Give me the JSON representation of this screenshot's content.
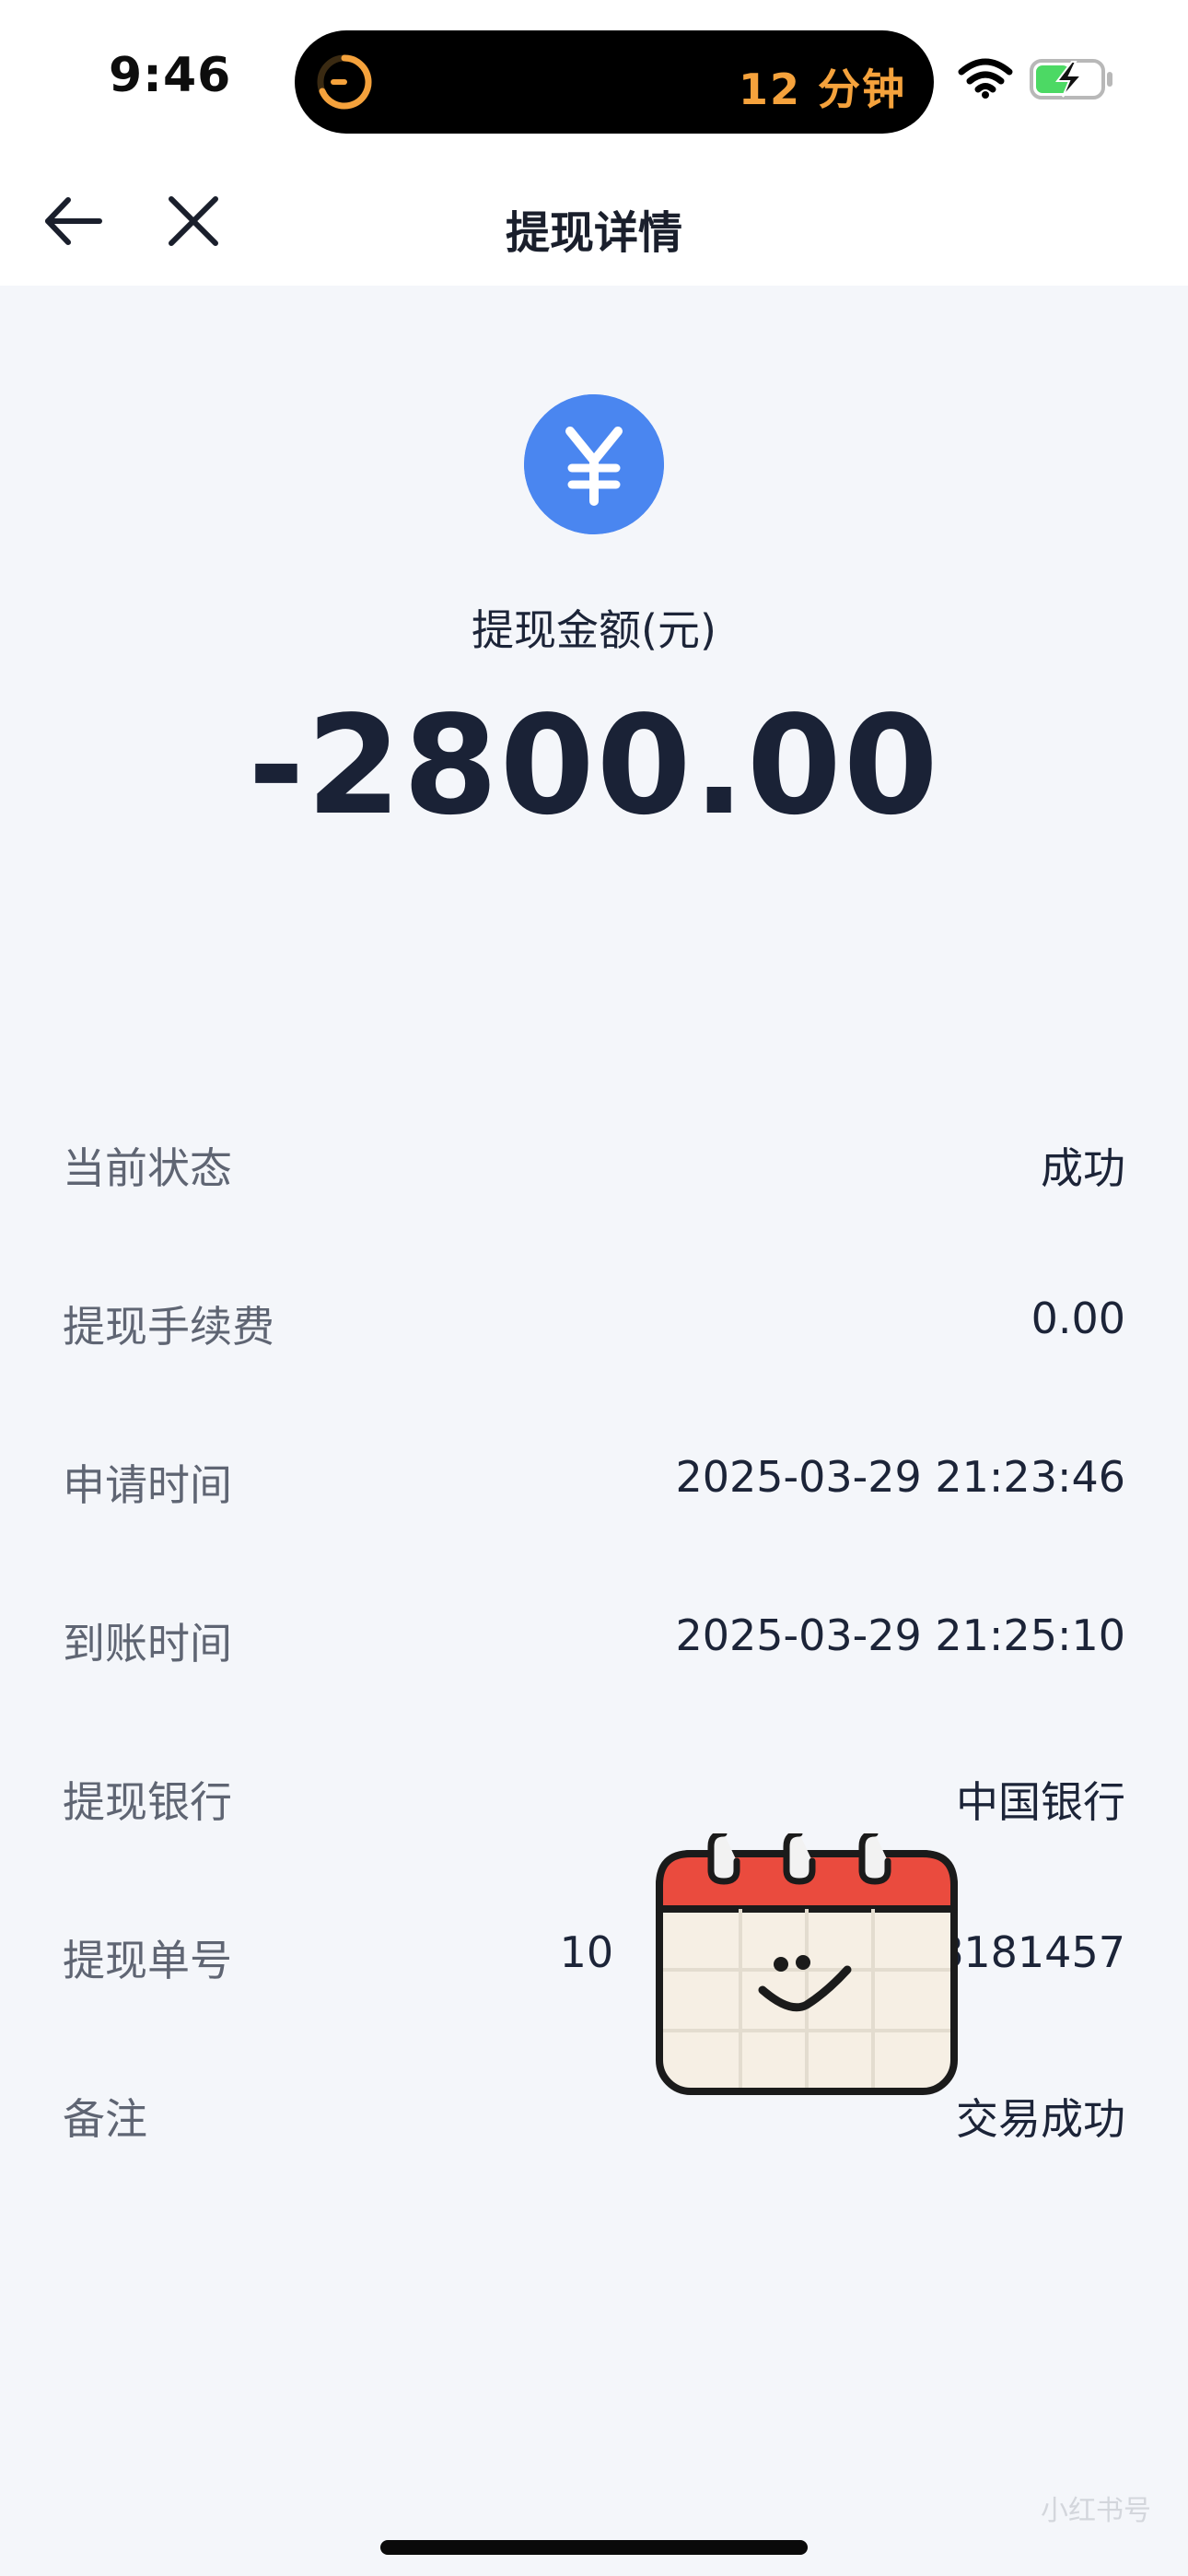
{
  "status_bar": {
    "time": "9:46",
    "island_timer_text": "12 分钟",
    "icons": [
      "timer-icon",
      "wifi-icon",
      "battery-charging-icon"
    ]
  },
  "nav": {
    "title": "提现详情",
    "icons": [
      "back-arrow-icon",
      "close-icon"
    ]
  },
  "header": {
    "icon": "yuan-icon",
    "icon_color": "#4a86f0",
    "amount_label": "提现金额(元)",
    "amount_value": "-2800.00"
  },
  "details": [
    {
      "label": "当前状态",
      "value": "成功"
    },
    {
      "label": "提现手续费",
      "value": "0.00"
    },
    {
      "label": "申请时间",
      "value": "2025-03-29 21:23:46"
    },
    {
      "label": "到账时间",
      "value": "2025-03-29 21:25:10"
    },
    {
      "label": "提现银行",
      "value": "中国银行"
    },
    {
      "label": "提现单号",
      "value": "10                        8181457"
    },
    {
      "label": "备注",
      "value": "交易成功"
    }
  ],
  "overlay": {
    "sticker": "calendar-smile-sticker"
  },
  "watermark": {
    "text": "小红书号"
  },
  "colors": {
    "accent_blue": "#4a86f0",
    "timer_orange": "#f5a23c",
    "battery_green": "#4cd964",
    "background": "#f4f6fa"
  }
}
